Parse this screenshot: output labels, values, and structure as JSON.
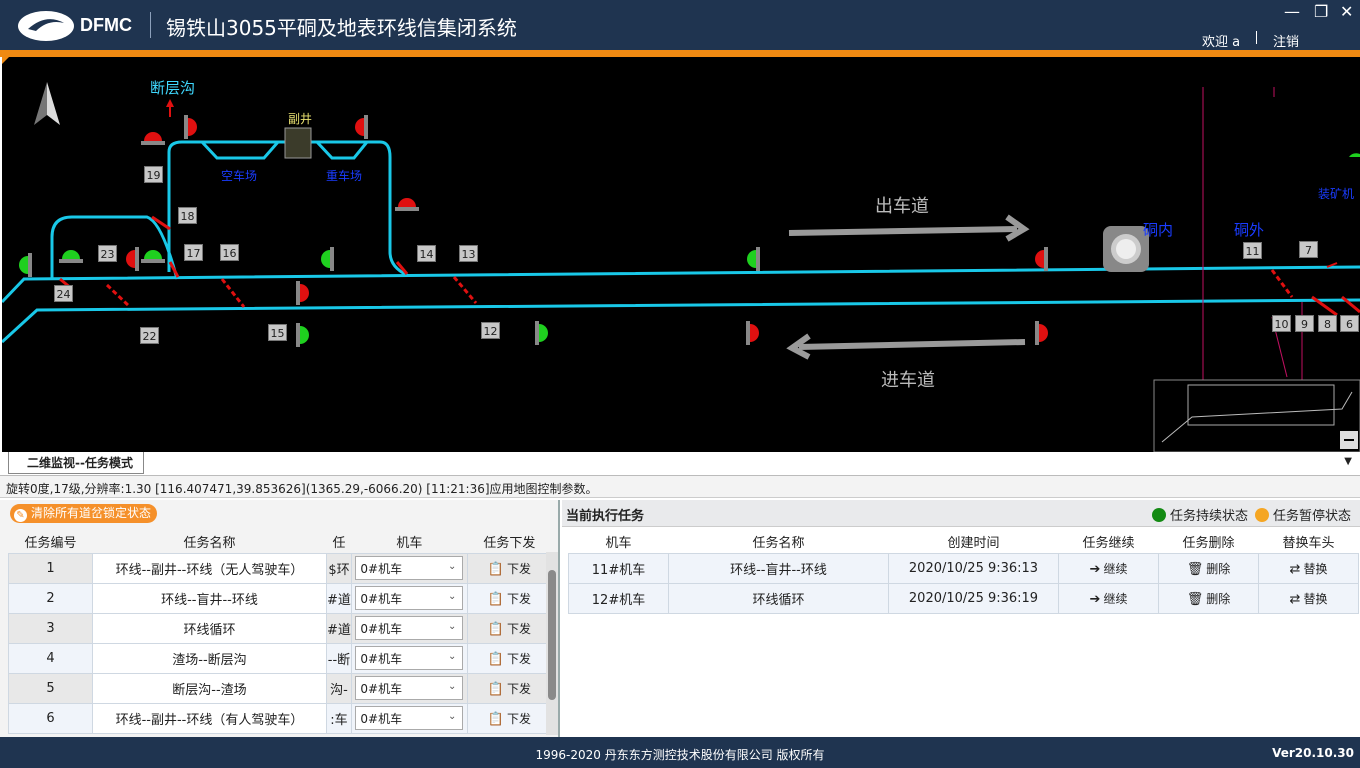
{
  "header": {
    "logo_text": "DFMC",
    "app_title": "锡铁山3055平硐及地表环线信集闭系统",
    "welcome": "欢迎 a",
    "logout": "注销",
    "window_controls": [
      "minimize-icon",
      "restore-icon",
      "close-icon"
    ]
  },
  "map": {
    "labels": {
      "duancenggou": "断层沟",
      "fujing": "副井",
      "kongchechang": "空车场",
      "zhongchechang": "重车场",
      "chuchedao": "出车道",
      "jinchedao": "进车道",
      "dongnei": "硐内",
      "dongwai": "硐外",
      "zhuangkuangji": "装矿机"
    },
    "numbers": [
      "19",
      "18",
      "23",
      "17",
      "16",
      "14",
      "13",
      "24",
      "22",
      "15",
      "12",
      "11",
      "7",
      "10",
      "9",
      "8",
      "6"
    ],
    "colors": {
      "track": "#19c8e8",
      "signal_red": "#e01010",
      "signal_green": "#1fd01f",
      "text_cyan": "#3fd9ff",
      "text_blue": "#1a3cff"
    }
  },
  "tabbar": {
    "tab_label": "二维监视--任务模式"
  },
  "statusline": {
    "text": "旋转0度,17级,分辨率:1.30  [116.407471,39.853626](1365.29,-6066.20)  [11:21:36]应用地图控制参数。"
  },
  "left": {
    "clear_button": "清除所有道岔锁定状态",
    "columns": [
      "任务编号",
      "任务名称",
      "任",
      "机车",
      "任务下发"
    ],
    "rows": [
      {
        "id": "1",
        "name": "环线--副井--环线（无人驾驶车）",
        "col3": "$环",
        "loco": "0#机车",
        "action": "下发"
      },
      {
        "id": "2",
        "name": "环线--盲井--环线",
        "col3": "#道",
        "loco": "0#机车",
        "action": "下发"
      },
      {
        "id": "3",
        "name": "环线循环",
        "col3": "#道",
        "loco": "0#机车",
        "action": "下发"
      },
      {
        "id": "4",
        "name": "渣场--断层沟",
        "col3": "--断",
        "loco": "0#机车",
        "action": "下发"
      },
      {
        "id": "5",
        "name": "断层沟--渣场",
        "col3": "沟-",
        "loco": "0#机车",
        "action": "下发"
      },
      {
        "id": "6",
        "name": "环线--副井--环线（有人驾驶车）",
        "col3": ":车",
        "loco": "0#机车",
        "action": "下发"
      }
    ]
  },
  "right": {
    "title": "当前执行任务",
    "legend": [
      {
        "label": "任务持续状态",
        "color": "#138a13"
      },
      {
        "label": "任务暂停状态",
        "color": "#f5a623"
      }
    ],
    "columns": [
      "机车",
      "任务名称",
      "创建时间",
      "任务继续",
      "任务删除",
      "替换车头"
    ],
    "rows": [
      {
        "loco": "11#机车",
        "name": "环线--盲井--环线",
        "time": "2020/10/25 9:36:13",
        "continue": "继续",
        "delete": "删除",
        "replace": "替换"
      },
      {
        "loco": "12#机车",
        "name": "环线循环",
        "time": "2020/10/25 9:36:19",
        "continue": "继续",
        "delete": "删除",
        "replace": "替换"
      }
    ]
  },
  "footer": {
    "copyright": "1996-2020 丹东东方测控技术股份有限公司 版权所有",
    "version": "Ver20.10.30"
  }
}
